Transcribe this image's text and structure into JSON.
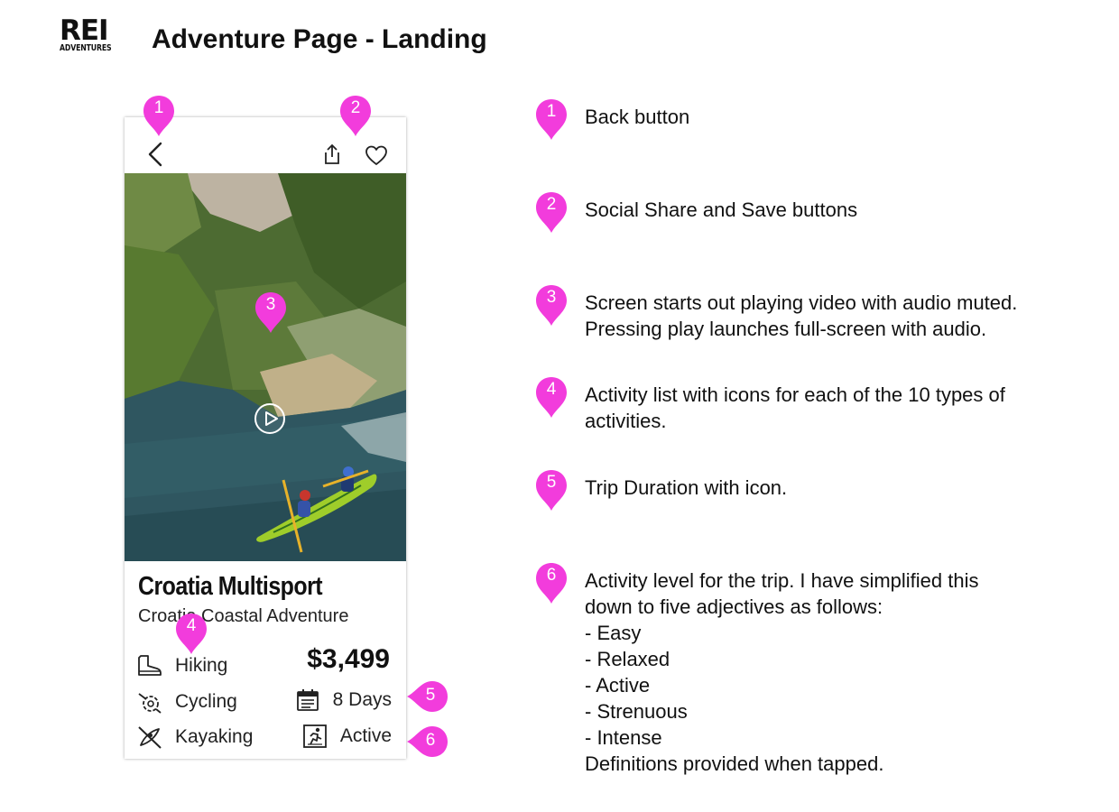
{
  "header": {
    "logo_main": "REI",
    "logo_sub": "ADVENTURES",
    "title": "Adventure Page - Landing"
  },
  "phone": {
    "trip_name": "Croatia Multisport",
    "trip_subtitle": "Croatia Coastal Adventure",
    "price": "$3,499",
    "activities": [
      {
        "label": "Hiking",
        "icon": "hiking-boot-icon"
      },
      {
        "label": "Cycling",
        "icon": "cycling-icon"
      },
      {
        "label": "Kayaking",
        "icon": "kayaking-icon"
      }
    ],
    "duration": {
      "label": "8 Days",
      "icon": "calendar-icon"
    },
    "level": {
      "label": "Active",
      "icon": "activity-level-icon"
    },
    "icons": {
      "back": "back-arrow-icon",
      "share": "share-icon",
      "save": "heart-icon",
      "play": "play-icon"
    }
  },
  "markers": [
    "1",
    "2",
    "3",
    "4",
    "5",
    "6"
  ],
  "annotations": [
    {
      "num": "1",
      "lines": [
        "Back button"
      ]
    },
    {
      "num": "2",
      "lines": [
        "Social Share and Save buttons"
      ]
    },
    {
      "num": "3",
      "lines": [
        "Screen starts out playing video with audio muted.",
        "Pressing play launches full-screen with audio."
      ]
    },
    {
      "num": "4",
      "lines": [
        "Activity list with icons for each of the 10 types of",
        "activities."
      ]
    },
    {
      "num": "5",
      "lines": [
        "Trip Duration with icon."
      ]
    },
    {
      "num": "6",
      "lines": [
        "Activity level for the trip. I have simplified this",
        "down to five adjectives as follows:",
        "- Easy",
        "- Relaxed",
        "- Active",
        "- Strenuous",
        "- Intense",
        "Definitions provided when tapped."
      ]
    }
  ],
  "colors": {
    "marker": "#f23cdc",
    "text": "#111111"
  }
}
